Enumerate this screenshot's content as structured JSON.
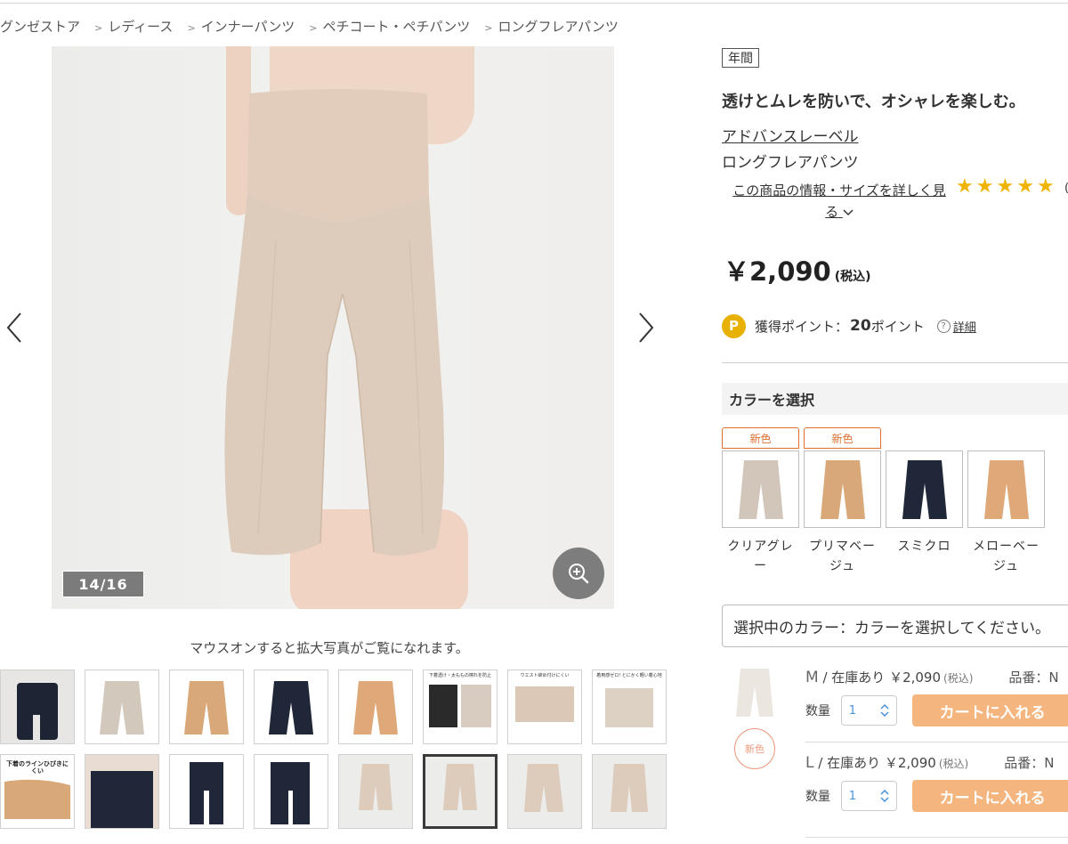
{
  "breadcrumb": [
    "グンゼストア",
    "レディース",
    "インナーパンツ",
    "ペチコート・ペチパンツ",
    "ロングフレアパンツ"
  ],
  "breadcrumb_separator": ">",
  "gallery": {
    "counter": "14/16",
    "hover_note": "マウスオンすると拡大写真がご覧になれます。",
    "thumbnails": [
      {
        "text": ""
      },
      {
        "text": ""
      },
      {
        "text": ""
      },
      {
        "text": ""
      },
      {
        "text": ""
      },
      {
        "text": "下着透け・太ももの擦れを防止"
      },
      {
        "text": "ウエスト締め付けにくい"
      },
      {
        "text": "着用感ゼロ! とにかく軽い着心地"
      },
      {
        "text": "下着のラインひびきにくい"
      },
      {
        "text": ""
      },
      {
        "text": ""
      },
      {
        "text": ""
      },
      {
        "text": ""
      },
      {
        "text": ""
      },
      {
        "text": ""
      },
      {
        "text": ""
      }
    ],
    "selected_thumbnail": 14
  },
  "product": {
    "season_badge": "年間",
    "catch_copy": "透けとムレを防いで、オシャレを楽しむ。",
    "brand": "アドバンスレーベル",
    "name": "ロングフレアパンツ",
    "detail_link_line1": "この商品の情報・サイズを詳しく見",
    "detail_link_line2": "る",
    "rating_stars": 5,
    "rating_tail": "(",
    "price": "￥2,090",
    "price_tax": "(税込)",
    "points_badge": "P",
    "points_label": "獲得ポイント：",
    "points_value": "20",
    "points_unit": "ポイント",
    "points_help": "詳細"
  },
  "colors": {
    "header": "カラーを選択",
    "new_label": "新色",
    "items": [
      {
        "name": "クリアグレー",
        "is_new": true,
        "hex": "#d1c6b9"
      },
      {
        "name": "プリマベージュ",
        "is_new": true,
        "hex": "#d9a878"
      },
      {
        "name": "スミクロ",
        "is_new": false,
        "hex": "#1f2738"
      },
      {
        "name": "メローベージュ",
        "is_new": false,
        "hex": "#dfa878"
      }
    ],
    "selected_prompt": "選択中のカラー：カラーを選択してください。"
  },
  "variants": {
    "new_label": "新色",
    "qty_label": "数量",
    "cart_label": "カートに入れる",
    "rows": [
      {
        "size": "M",
        "stock": "在庫あり",
        "price": "￥2,090",
        "tax": "(税込)",
        "code_label": "品番：N",
        "qty": "1"
      },
      {
        "size": "L",
        "stock": "在庫あり",
        "price": "￥2,090",
        "tax": "(税込)",
        "code_label": "品番：N",
        "qty": "1"
      }
    ]
  },
  "colors_theme": {
    "accent": "#f5b57e",
    "star": "#f0b400",
    "new": "#e07030"
  }
}
